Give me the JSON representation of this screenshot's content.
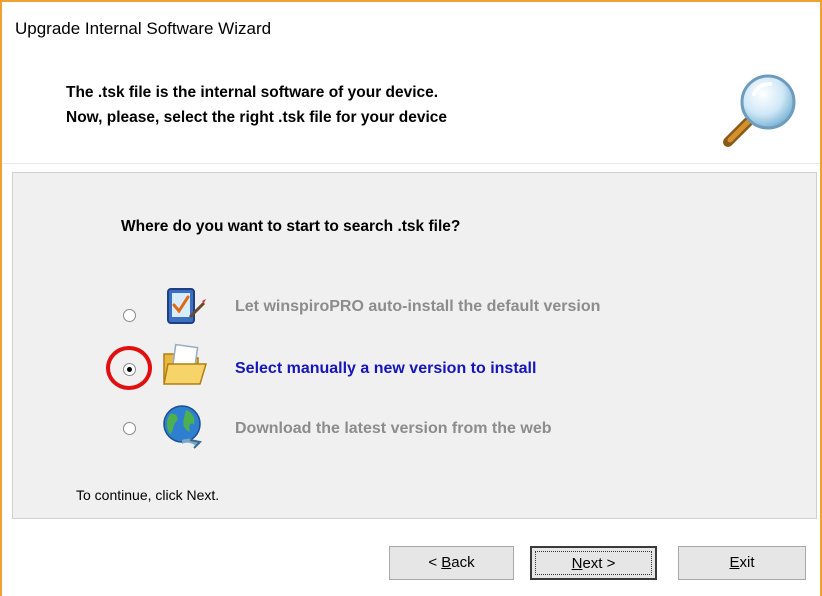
{
  "window": {
    "title": "Upgrade Internal Software Wizard"
  },
  "header": {
    "line1": "The .tsk file is the internal software of your device.",
    "line2": "Now, please, select the right .tsk file for your device",
    "icon": "magnifier-icon"
  },
  "main": {
    "question": "Where do you want to start to search .tsk file?",
    "options": [
      {
        "label": "Let winspiroPRO auto-install the default version",
        "icon": "tablet-check-icon",
        "selected": false,
        "enabled": false
      },
      {
        "label": "Select manually a new version to install",
        "icon": "open-folder-icon",
        "selected": true,
        "enabled": true
      },
      {
        "label": "Download the latest version from the web",
        "icon": "globe-icon",
        "selected": false,
        "enabled": false
      }
    ],
    "hint": "To continue, click Next."
  },
  "buttons": {
    "back": {
      "pre": "< ",
      "mnemonic": "B",
      "post": "ack"
    },
    "next": {
      "pre": "",
      "mnemonic": "N",
      "post": "ext >"
    },
    "exit": {
      "pre": "",
      "mnemonic": "E",
      "post": "xit"
    }
  },
  "colors": {
    "accent_border": "#f0a030",
    "selected_text": "#1515b8",
    "disabled_text": "#8c8c8c",
    "highlight_ring": "#e01010"
  }
}
